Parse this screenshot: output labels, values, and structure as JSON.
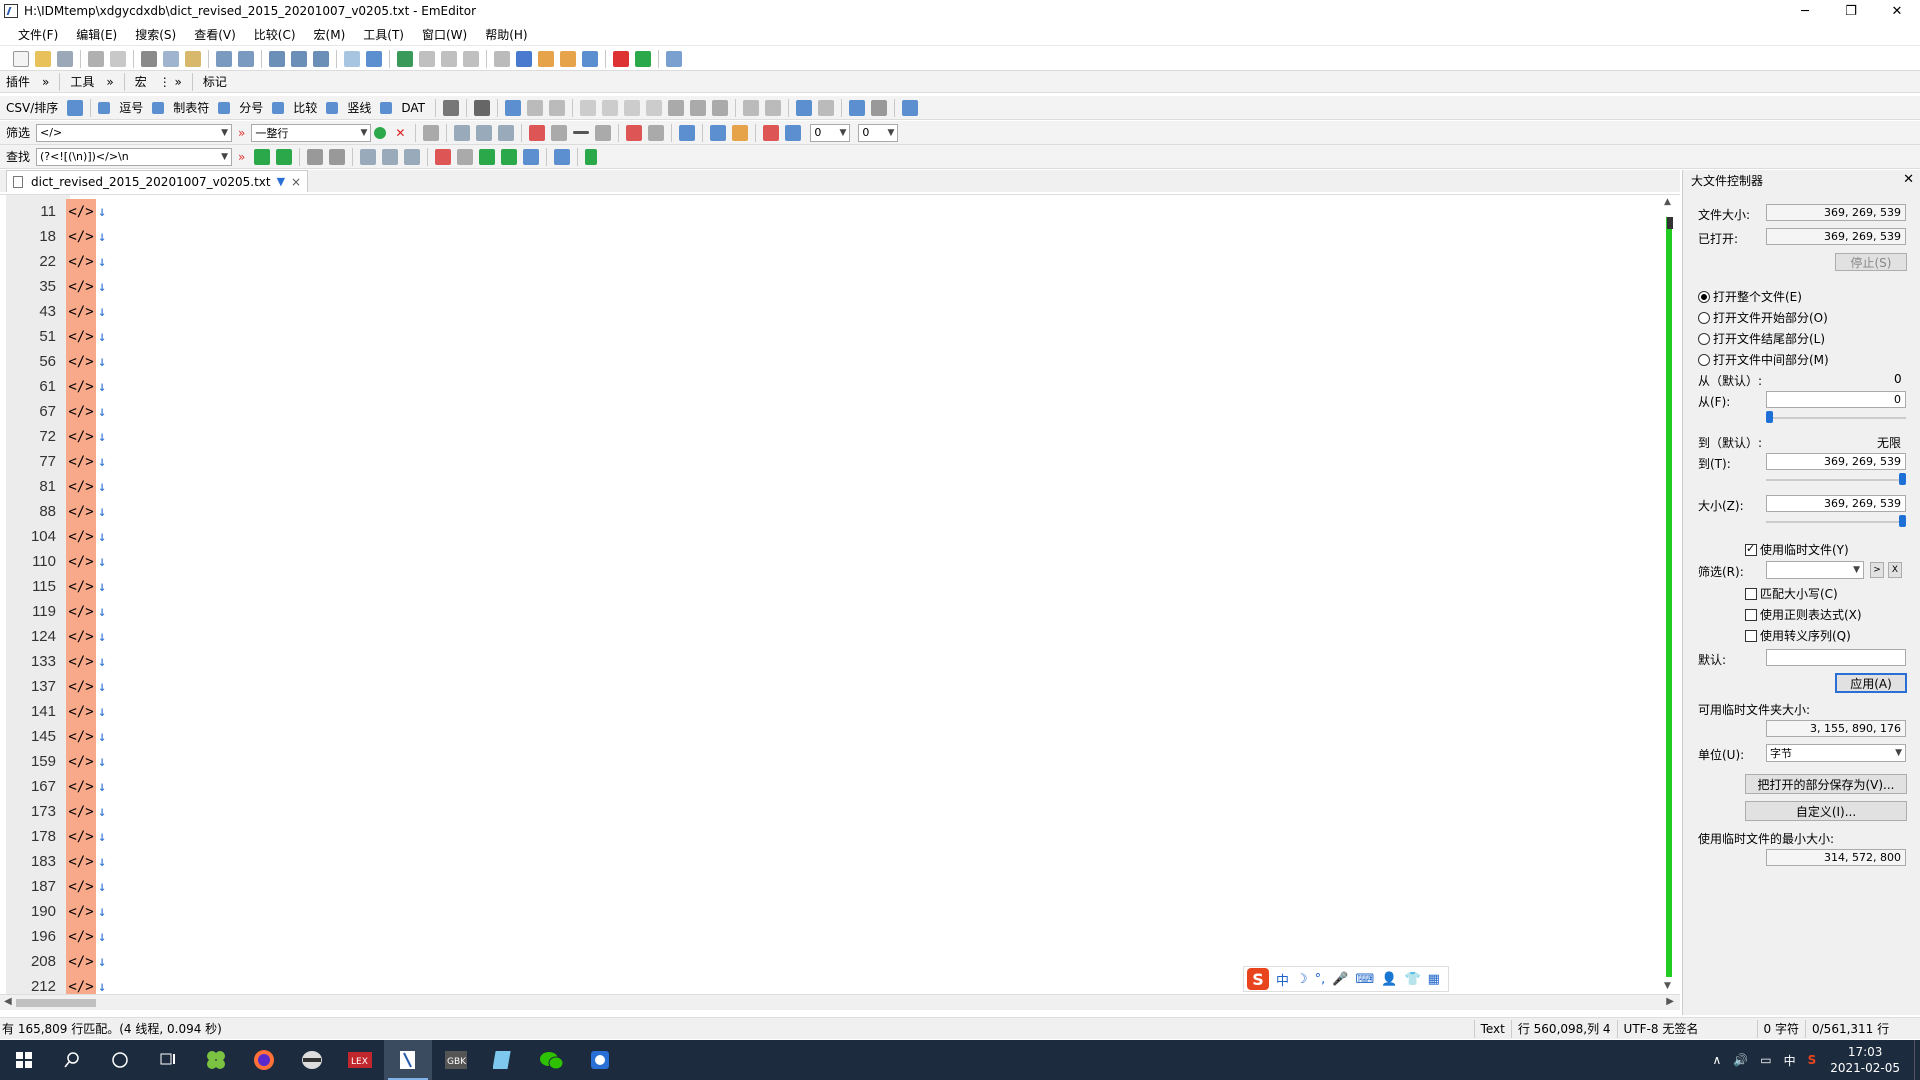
{
  "window": {
    "title": "H:\\IDMtemp\\xdgycdxdb\\dict_revised_2015_20201007_v0205.txt - EmEditor"
  },
  "menu": [
    "文件(F)",
    "编辑(E)",
    "搜索(S)",
    "查看(V)",
    "比较(C)",
    "宏(M)",
    "工具(T)",
    "窗口(W)",
    "帮助(H)"
  ],
  "toolbar2": {
    "plugins": "插件",
    "tools": "工具",
    "macros": "宏",
    "marker": "标记"
  },
  "csvbar": {
    "label": "CSV/排序",
    "items": [
      "逗号",
      "制表符",
      "分号",
      "比较",
      "竖线",
      "DAT"
    ]
  },
  "filterbar": {
    "label": "筛选",
    "value": "</>",
    "mode": "一整行",
    "num1": "0",
    "num2": "0"
  },
  "findbar": {
    "label": "查找",
    "value": "(?<![(\\n)])</>\\n"
  },
  "tab": {
    "name": "dict_revised_2015_20201007_v0205.txt"
  },
  "editor": {
    "line_text": "</>",
    "line_numbers": [
      "11",
      "18",
      "22",
      "35",
      "43",
      "51",
      "56",
      "61",
      "67",
      "72",
      "77",
      "81",
      "88",
      "104",
      "110",
      "115",
      "119",
      "124",
      "133",
      "137",
      "141",
      "145",
      "159",
      "167",
      "173",
      "178",
      "183",
      "187",
      "190",
      "196",
      "208",
      "212"
    ]
  },
  "panel": {
    "title": "大文件控制器",
    "file_size_label": "文件大小:",
    "file_size": "369, 269, 539",
    "opened_label": "已打开:",
    "opened": "369, 269, 539",
    "stop_button": "停止(S)",
    "radio_whole": "打开整个文件(E)",
    "radio_begin": "打开文件开始部分(O)",
    "radio_end": "打开文件结尾部分(L)",
    "radio_middle": "打开文件中间部分(M)",
    "from_default_label": "从（默认）:",
    "from_default": "0",
    "from_label": "从(F):",
    "from_value": "0",
    "to_default_label": "到（默认）:",
    "to_default": "无限",
    "to_label": "到(T):",
    "to_value": "369, 269, 539",
    "size_label": "大小(Z):",
    "size_value": "369, 269, 539",
    "use_temp": "使用临时文件(Y)",
    "filter_label": "筛选(R):",
    "match_case": "匹配大小写(C)",
    "use_regex": "使用正则表达式(X)",
    "use_escape": "使用转义序列(Q)",
    "default_label": "默认:",
    "apply_button": "应用(A)",
    "temp_folder_label": "可用临时文件夹大小:",
    "temp_folder_size": "3, 155, 890, 176",
    "unit_label": "单位(U):",
    "unit_value": "字节",
    "save_part_button": "把打开的部分保存为(V)...",
    "custom_button": "自定义(I)...",
    "min_temp_label": "使用临时文件的最小大小:",
    "min_temp_value": "314, 572, 800",
    "slider_from": 0.0,
    "slider_to": 1.0,
    "slider_size": 1.0
  },
  "ime": {
    "items": [
      "中",
      "☽",
      "°,",
      "🎤",
      "⌨",
      "👤",
      "👕",
      "▦"
    ]
  },
  "status": {
    "left": "有 165,809 行匹配。(4 线程, 0.094 秒)",
    "mode": "Text",
    "pos": "行 560,098,列 4",
    "enc": "UTF-8 无签名",
    "chars": "0 字符",
    "lines": "0/561,311 行"
  },
  "taskbar": {
    "time": "17:03",
    "date": "2021-02-05",
    "tray": [
      "∧",
      "🔊",
      "▭",
      "中",
      "S"
    ]
  },
  "colors": {
    "line_bg": "#f7a98a",
    "eol": "#2a6fd6",
    "green_bar": "#22cc22",
    "taskbar": "#1c2b3d"
  }
}
